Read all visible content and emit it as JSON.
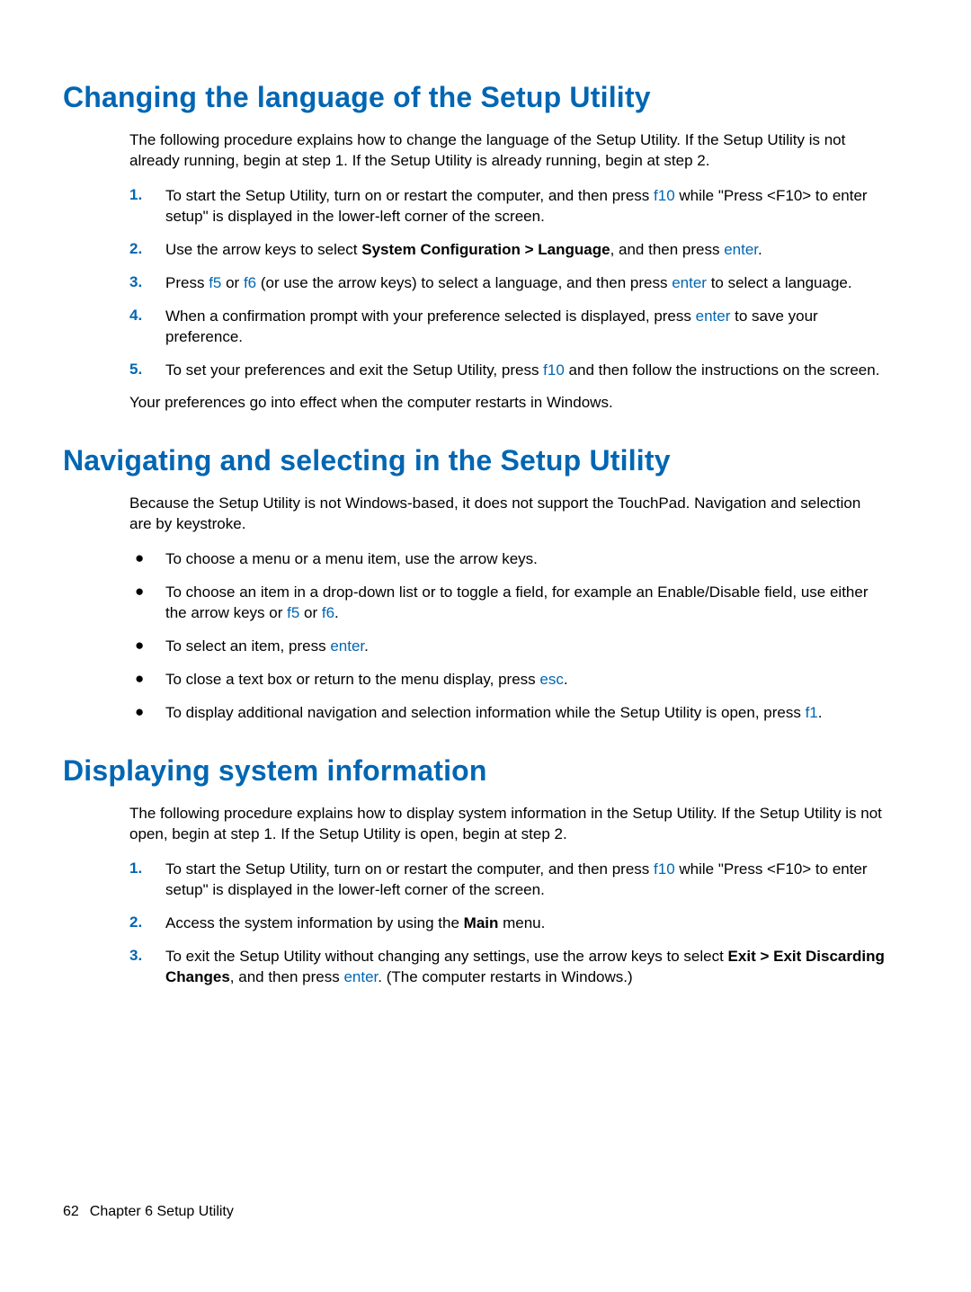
{
  "section1": {
    "title": "Changing the language of the Setup Utility",
    "intro": "The following procedure explains how to change the language of the Setup Utility. If the Setup Utility is not already running, begin at step 1. If the Setup Utility is already running, begin at step 2.",
    "steps": {
      "s1a": "To start the Setup Utility, turn on or restart the computer, and then press ",
      "s1key": "f10",
      "s1b": " while \"Press <F10> to enter setup\" is displayed in the lower-left corner of the screen.",
      "s2a": "Use the arrow keys to select ",
      "s2bold": "System Configuration > Language",
      "s2b": ", and then press ",
      "s2key": "enter",
      "s2c": ".",
      "s3a": "Press ",
      "s3key1": "f5",
      "s3b": " or ",
      "s3key2": "f6",
      "s3c": " (or use the arrow keys) to select a language, and then press ",
      "s3key3": "enter",
      "s3d": " to select a language.",
      "s4a": "When a confirmation prompt with your preference selected is displayed, press ",
      "s4key": "enter",
      "s4b": " to save your preference.",
      "s5a": "To set your preferences and exit the Setup Utility, press ",
      "s5key": "f10",
      "s5b": " and then follow the instructions on the screen."
    },
    "outro": "Your preferences go into effect when the computer restarts in Windows.",
    "nums": {
      "n1": "1.",
      "n2": "2.",
      "n3": "3.",
      "n4": "4.",
      "n5": "5."
    }
  },
  "section2": {
    "title": "Navigating and selecting in the Setup Utility",
    "intro": "Because the Setup Utility is not Windows-based, it does not support the TouchPad. Navigation and selection are by keystroke.",
    "bullets": {
      "b1": "To choose a menu or a menu item, use the arrow keys.",
      "b2a": "To choose an item in a drop-down list or to toggle a field, for example an Enable/Disable field, use either the arrow keys or ",
      "b2k1": "f5",
      "b2b": " or ",
      "b2k2": "f6",
      "b2c": ".",
      "b3a": "To select an item, press ",
      "b3k": "enter",
      "b3b": ".",
      "b4a": "To close a text box or return to the menu display, press ",
      "b4k": "esc",
      "b4b": ".",
      "b5a": "To display additional navigation and selection information while the Setup Utility is open, press ",
      "b5k": "f1",
      "b5b": "."
    },
    "bullet": "●"
  },
  "section3": {
    "title": "Displaying system information",
    "intro": "The following procedure explains how to display system information in the Setup Utility. If the Setup Utility is not open, begin at step 1. If the Setup Utility is open, begin at step 2.",
    "steps": {
      "s1a": "To start the Setup Utility, turn on or restart the computer, and then press ",
      "s1key": "f10",
      "s1b": " while \"Press <F10> to enter setup\" is displayed in the lower-left corner of the screen.",
      "s2a": "Access the system information by using the ",
      "s2bold": "Main",
      "s2b": " menu.",
      "s3a": "To exit the Setup Utility without changing any settings, use the arrow keys to select ",
      "s3bold": "Exit > Exit Discarding Changes",
      "s3b": ", and then press ",
      "s3key": "enter",
      "s3c": ". (The computer restarts in Windows.)"
    },
    "nums": {
      "n1": "1.",
      "n2": "2.",
      "n3": "3."
    }
  },
  "footer": {
    "page": "62",
    "chapter": "Chapter 6   Setup Utility"
  }
}
